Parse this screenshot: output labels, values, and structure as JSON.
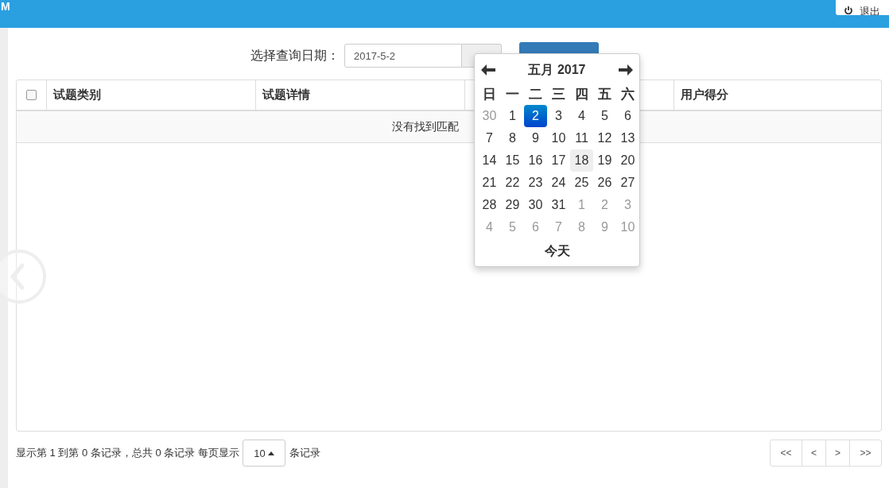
{
  "header": {
    "brand": "M",
    "logout": {
      "label": "退出"
    }
  },
  "query": {
    "label": "选择查询日期：",
    "date_value": "2017-5-2"
  },
  "table": {
    "select_all": {
      "checked": false
    },
    "columns": [
      {
        "label": "试题类别"
      },
      {
        "label": "试题详情"
      },
      {
        "label": "用户得分"
      }
    ],
    "empty_message": "没有找到匹配"
  },
  "calendar": {
    "title": "五月 2017",
    "weekdays": [
      "日",
      "一",
      "二",
      "三",
      "四",
      "五",
      "六"
    ],
    "weeks": [
      [
        {
          "day": "30",
          "in_month": false,
          "selected": false,
          "today": false
        },
        {
          "day": "1",
          "in_month": true,
          "selected": false,
          "today": false
        },
        {
          "day": "2",
          "in_month": true,
          "selected": true,
          "today": false
        },
        {
          "day": "3",
          "in_month": true,
          "selected": false,
          "today": false
        },
        {
          "day": "4",
          "in_month": true,
          "selected": false,
          "today": false
        },
        {
          "day": "5",
          "in_month": true,
          "selected": false,
          "today": false
        },
        {
          "day": "6",
          "in_month": true,
          "selected": false,
          "today": false
        }
      ],
      [
        {
          "day": "7",
          "in_month": true,
          "selected": false,
          "today": false
        },
        {
          "day": "8",
          "in_month": true,
          "selected": false,
          "today": false
        },
        {
          "day": "9",
          "in_month": true,
          "selected": false,
          "today": false
        },
        {
          "day": "10",
          "in_month": true,
          "selected": false,
          "today": false
        },
        {
          "day": "11",
          "in_month": true,
          "selected": false,
          "today": false
        },
        {
          "day": "12",
          "in_month": true,
          "selected": false,
          "today": false
        },
        {
          "day": "13",
          "in_month": true,
          "selected": false,
          "today": false
        }
      ],
      [
        {
          "day": "14",
          "in_month": true,
          "selected": false,
          "today": false
        },
        {
          "day": "15",
          "in_month": true,
          "selected": false,
          "today": false
        },
        {
          "day": "16",
          "in_month": true,
          "selected": false,
          "today": false
        },
        {
          "day": "17",
          "in_month": true,
          "selected": false,
          "today": false
        },
        {
          "day": "18",
          "in_month": true,
          "selected": false,
          "today": true
        },
        {
          "day": "19",
          "in_month": true,
          "selected": false,
          "today": false
        },
        {
          "day": "20",
          "in_month": true,
          "selected": false,
          "today": false
        }
      ],
      [
        {
          "day": "21",
          "in_month": true,
          "selected": false,
          "today": false
        },
        {
          "day": "22",
          "in_month": true,
          "selected": false,
          "today": false
        },
        {
          "day": "23",
          "in_month": true,
          "selected": false,
          "today": false
        },
        {
          "day": "24",
          "in_month": true,
          "selected": false,
          "today": false
        },
        {
          "day": "25",
          "in_month": true,
          "selected": false,
          "today": false
        },
        {
          "day": "26",
          "in_month": true,
          "selected": false,
          "today": false
        },
        {
          "day": "27",
          "in_month": true,
          "selected": false,
          "today": false
        }
      ],
      [
        {
          "day": "28",
          "in_month": true,
          "selected": false,
          "today": false
        },
        {
          "day": "29",
          "in_month": true,
          "selected": false,
          "today": false
        },
        {
          "day": "30",
          "in_month": true,
          "selected": false,
          "today": false
        },
        {
          "day": "31",
          "in_month": true,
          "selected": false,
          "today": false
        },
        {
          "day": "1",
          "in_month": false,
          "selected": false,
          "today": false
        },
        {
          "day": "2",
          "in_month": false,
          "selected": false,
          "today": false
        },
        {
          "day": "3",
          "in_month": false,
          "selected": false,
          "today": false
        }
      ],
      [
        {
          "day": "4",
          "in_month": false,
          "selected": false,
          "today": false
        },
        {
          "day": "5",
          "in_month": false,
          "selected": false,
          "today": false
        },
        {
          "day": "6",
          "in_month": false,
          "selected": false,
          "today": false
        },
        {
          "day": "7",
          "in_month": false,
          "selected": false,
          "today": false
        },
        {
          "day": "8",
          "in_month": false,
          "selected": false,
          "today": false
        },
        {
          "day": "9",
          "in_month": false,
          "selected": false,
          "today": false
        },
        {
          "day": "10",
          "in_month": false,
          "selected": false,
          "today": false
        }
      ]
    ],
    "today_button": "今天"
  },
  "footer": {
    "summary": "显示第 1 到第 0 条记录，总共 0 条记录 每页显示",
    "page_size": "10",
    "suffix": "条记录",
    "pages": [
      "<<",
      "<",
      ">",
      ">>"
    ]
  }
}
